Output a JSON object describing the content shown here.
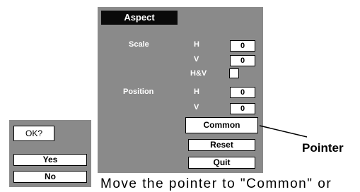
{
  "panel": {
    "title": "Aspect",
    "scale_label": "Scale",
    "position_label": "Position",
    "scale_h_label": "H",
    "scale_h_value": "0",
    "scale_v_label": "V",
    "scale_v_value": "0",
    "hv_label": "H&V",
    "position_h_label": "H",
    "position_h_value": "0",
    "position_v_label": "V",
    "position_v_value": "0",
    "buttons": {
      "common": "Common",
      "reset": "Reset",
      "quit": "Quit"
    }
  },
  "callout": {
    "label": "Pointer"
  },
  "dialog": {
    "title": "OK?",
    "yes": "Yes",
    "no": "No"
  },
  "caption": "Move the pointer to \"Common\" or",
  "colors": {
    "panel_bg": "#8a8a8a",
    "title_bg": "#0a0a0a",
    "text_light": "#ffffff",
    "text_dark": "#000000"
  }
}
